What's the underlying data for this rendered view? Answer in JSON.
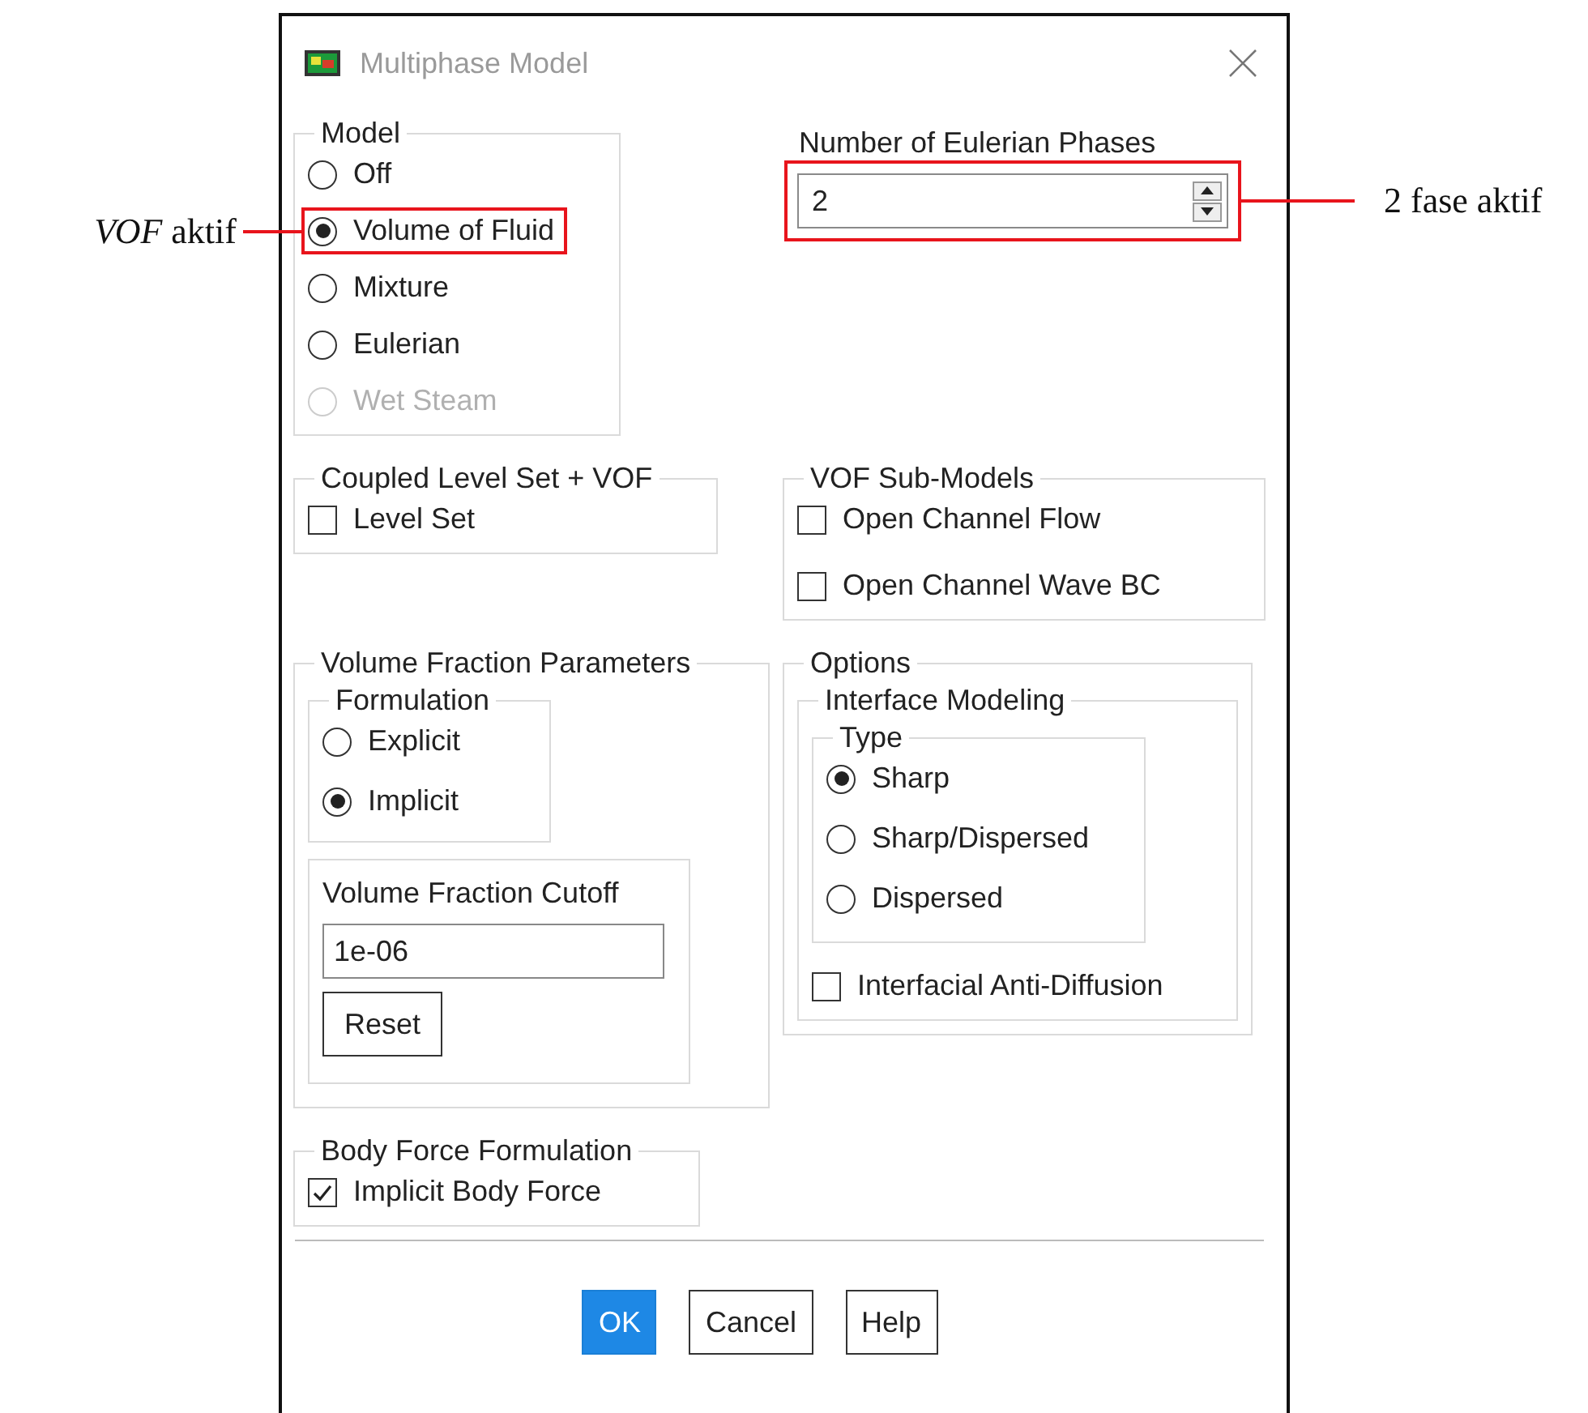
{
  "window": {
    "title": "Multiphase Model"
  },
  "model": {
    "label": "Model",
    "options": [
      {
        "label": "Off",
        "selected": false,
        "disabled": false
      },
      {
        "label": "Volume of Fluid",
        "selected": true,
        "disabled": false,
        "annotation": "*VOF* aktif"
      },
      {
        "label": "Mixture",
        "selected": false,
        "disabled": false
      },
      {
        "label": "Eulerian",
        "selected": false,
        "disabled": false
      },
      {
        "label": "Wet Steam",
        "selected": false,
        "disabled": true
      }
    ]
  },
  "eulerian_phases": {
    "label": "Number of Eulerian Phases",
    "value": "2",
    "annotation": "2 fase aktif"
  },
  "coupled_level_set": {
    "label": "Coupled Level Set + VOF",
    "options": [
      {
        "label": "Level Set",
        "checked": false
      }
    ]
  },
  "vof_sub_models": {
    "label": "VOF Sub-Models",
    "options": [
      {
        "label": "Open Channel Flow",
        "checked": false
      },
      {
        "label": "Open Channel Wave BC",
        "checked": false
      }
    ]
  },
  "volume_fraction_parameters": {
    "label": "Volume Fraction Parameters",
    "formulation": {
      "label": "Formulation",
      "options": [
        {
          "label": "Explicit",
          "selected": false
        },
        {
          "label": "Implicit",
          "selected": true
        }
      ]
    },
    "cutoff": {
      "label": "Volume Fraction Cutoff",
      "value": "1e-06",
      "button": "Reset"
    }
  },
  "options": {
    "label": "Options",
    "interface_modeling": {
      "label": "Interface Modeling",
      "type": {
        "label": "Type",
        "options": [
          {
            "label": "Sharp",
            "selected": true
          },
          {
            "label": "Sharp/Dispersed",
            "selected": false
          },
          {
            "label": "Dispersed",
            "selected": false
          }
        ]
      },
      "anti_diffusion": {
        "label": "Interfacial Anti-Diffusion",
        "checked": false
      }
    }
  },
  "body_force": {
    "label": "Body Force Formulation",
    "options": [
      {
        "label": "Implicit Body Force",
        "checked": true
      }
    ]
  },
  "buttons": [
    {
      "label": "OK",
      "default": true
    },
    {
      "label": "Cancel",
      "default": false
    },
    {
      "label": "Help",
      "default": false
    }
  ]
}
